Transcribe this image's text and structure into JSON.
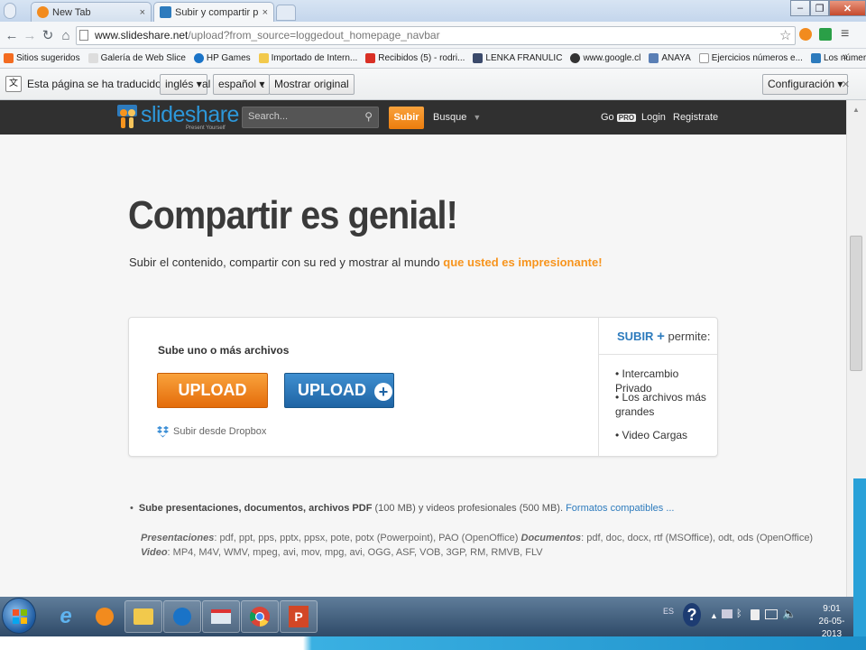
{
  "browser": {
    "tabs": [
      {
        "label": "New Tab",
        "active": false
      },
      {
        "label": "Subir y compartir presentac",
        "active": true
      }
    ],
    "address": {
      "host": "www.slideshare.net",
      "path": "/upload?from_source=loggedout_homepage_navbar"
    },
    "bookmarks": [
      "Sitios sugeridos",
      "Galería de Web Slice",
      "HP Games",
      "Importado de Intern...",
      "Recibidos (5) - rodri...",
      "LENKA FRANULIC",
      "www.google.cl",
      "ANAYA",
      "Ejercicios números e...",
      "Los números entero..."
    ],
    "bookmarks_more": "»",
    "translate": {
      "prefix": "Esta página se ha traducido del",
      "from_lang": "inglés",
      "connector": "al",
      "to_lang": "español",
      "dot": ".",
      "show_original": "Mostrar original",
      "settings": "Configuración",
      "close": "×"
    }
  },
  "site": {
    "logo_text": "slideshare",
    "logo_tagline": "Present Yourself",
    "search_placeholder": "Search...",
    "subir_btn": "Subir",
    "busque": "Busque",
    "go": "Go",
    "pro": "PRO",
    "login": "Login",
    "register": "Registrate"
  },
  "hero": {
    "title": "Compartir es genial!",
    "subtitle_plain": "Subir el contenido, compartir con su red y mostrar al mundo ",
    "subtitle_highlight": "que usted es impresionante!"
  },
  "upload_card": {
    "label": "Sube uno o más archivos",
    "upload_btn": "UPLOAD",
    "upload_plus_btn": "UPLOAD",
    "dropbox": "Subir desde Dropbox",
    "side_title_strong": "SUBIR",
    "side_title_rest": "permite:",
    "side_items": [
      "Intercambio Privado",
      "Los archivos más grandes",
      "Video Cargas"
    ]
  },
  "info": {
    "lead": "Sube presentaciones, documentos, archivos PDF",
    "pdf_size": "(100 MB)",
    "mid": "y videos profesionales (500 MB).",
    "formats_link": "Formatos compatibles ...",
    "presentaciones_label": "Presentaciones",
    "presentaciones_list": ": pdf, ppt, pps, pptx, ppsx, pote, potx (Powerpoint), PAO (OpenOffice)",
    "documentos_label": "Documentos",
    "documentos_list": ": pdf, doc, docx, rtf (MSOffice), odt, ods (OpenOffice)",
    "video_label": "Video",
    "video_list": ": MP4, M4V, WMV, mpeg, avi, mov, mpg, avi, OGG, ASF, VOB, 3GP, RM, RMVB, FLV"
  },
  "taskbar": {
    "lang": "ES",
    "time": "9:01",
    "date": "26-05-2013"
  },
  "colors": {
    "orange": "#f7941d",
    "blue": "#2d7bbd",
    "nav": "#303030"
  }
}
